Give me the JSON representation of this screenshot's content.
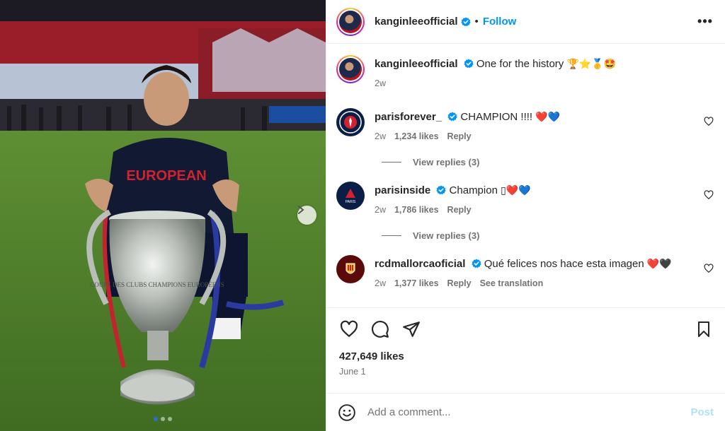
{
  "post": {
    "author": "kanginleeofficial",
    "follow_label": "Follow",
    "more_label": "•••",
    "caption": "One for the history",
    "caption_emoji": "🏆⭐🥇🤩",
    "caption_time": "2w",
    "likes": "427,649 likes",
    "date": "June 1",
    "carousel": {
      "total": 3,
      "active": 1
    }
  },
  "comments": [
    {
      "user": "parisforever_",
      "text": "CHAMPION !!!!",
      "emoji": "❤️💙",
      "time": "2w",
      "likes": "1,234 likes",
      "reply_label": "Reply",
      "replies": "View replies (3)"
    },
    {
      "user": "parisinside",
      "text": "Champion",
      "emoji": "▯❤️💙",
      "time": "2w",
      "likes": "1,786 likes",
      "reply_label": "Reply",
      "replies": "View replies (3)"
    },
    {
      "user": "rcdmallorcaoficial",
      "text": "Qué felices nos hace esta imagen",
      "emoji": "❤️🖤",
      "time": "2w",
      "likes": "1,377 likes",
      "reply_label": "Reply",
      "translate_label": "See translation"
    }
  ],
  "composer": {
    "placeholder": "Add a comment...",
    "post_label": "Post"
  },
  "photo_text": {
    "shirt": "EUROPEAN",
    "trophy": "COUPE DES CLUBS CHAMPIONS EUROPÉENS"
  },
  "colors": {
    "accent": "#0095f6",
    "post_disabled": "#b2dffc",
    "verified": "#0095f6",
    "muted": "#737373"
  },
  "icons": [
    "verified-badge",
    "more-icon",
    "heart-icon",
    "comment-icon",
    "share-icon",
    "bookmark-icon",
    "emoji-icon",
    "chevron-right-icon"
  ]
}
